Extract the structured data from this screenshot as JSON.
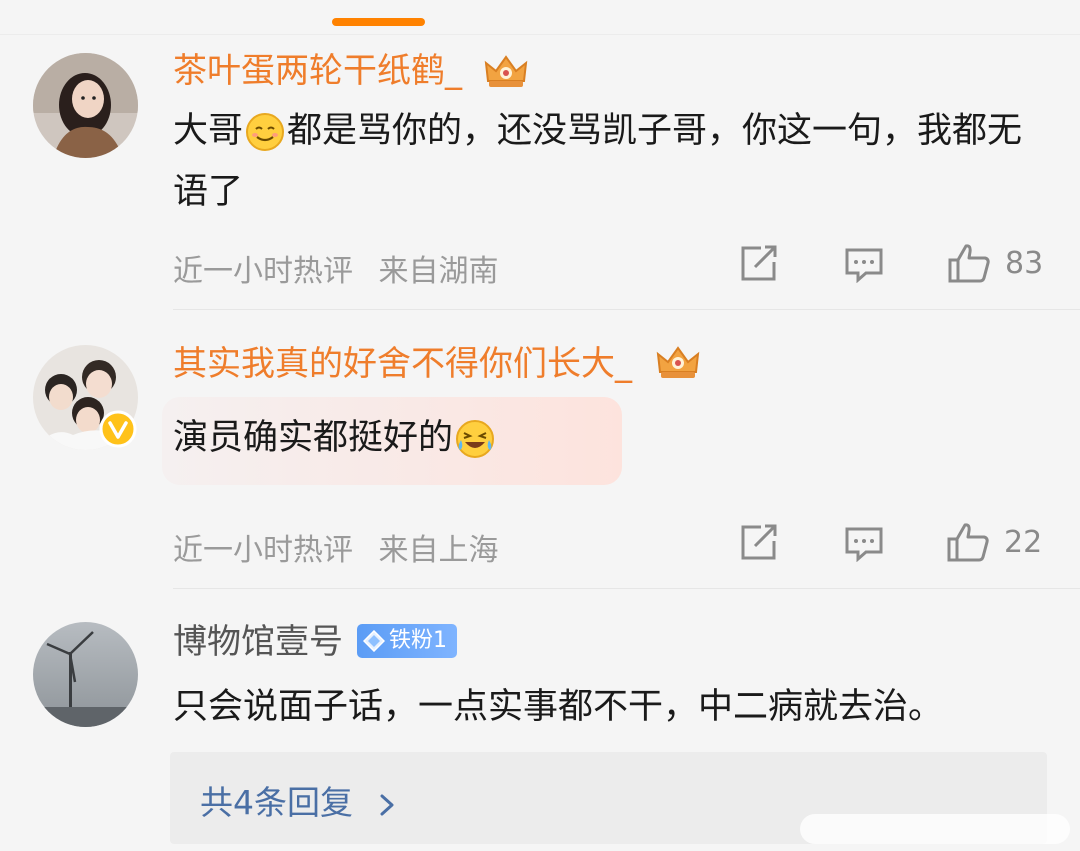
{
  "comments": [
    {
      "username": "茶叶蛋两轮干纸鹤_",
      "text_before": "大哥",
      "text_after": "都是骂你的，还没骂凯子哥，你这一句，我都无语了",
      "time": "近一小时热评",
      "location": "来自湖南",
      "likes": "83"
    },
    {
      "username": "其实我真的好舍不得你们长大_",
      "text": "演员确实都挺好的",
      "time": "近一小时热评",
      "location": "来自上海",
      "likes": "22"
    },
    {
      "username": "博物馆壹号",
      "badge": "铁粉1",
      "text": "只会说面子话，一点实事都不干，中二病就去治。",
      "replies": "共4条回复"
    }
  ],
  "icons": {
    "share": "share-icon",
    "comment": "comment-icon",
    "like": "thumbs-up-icon",
    "crown": "crown-icon",
    "verified": "verified-icon",
    "chevron": "chevron-right-icon"
  },
  "colors": {
    "accent": "#ff8200",
    "vip_name": "#ef7d2b",
    "link": "#4a6fa5",
    "badge": "#5b9cf5"
  }
}
